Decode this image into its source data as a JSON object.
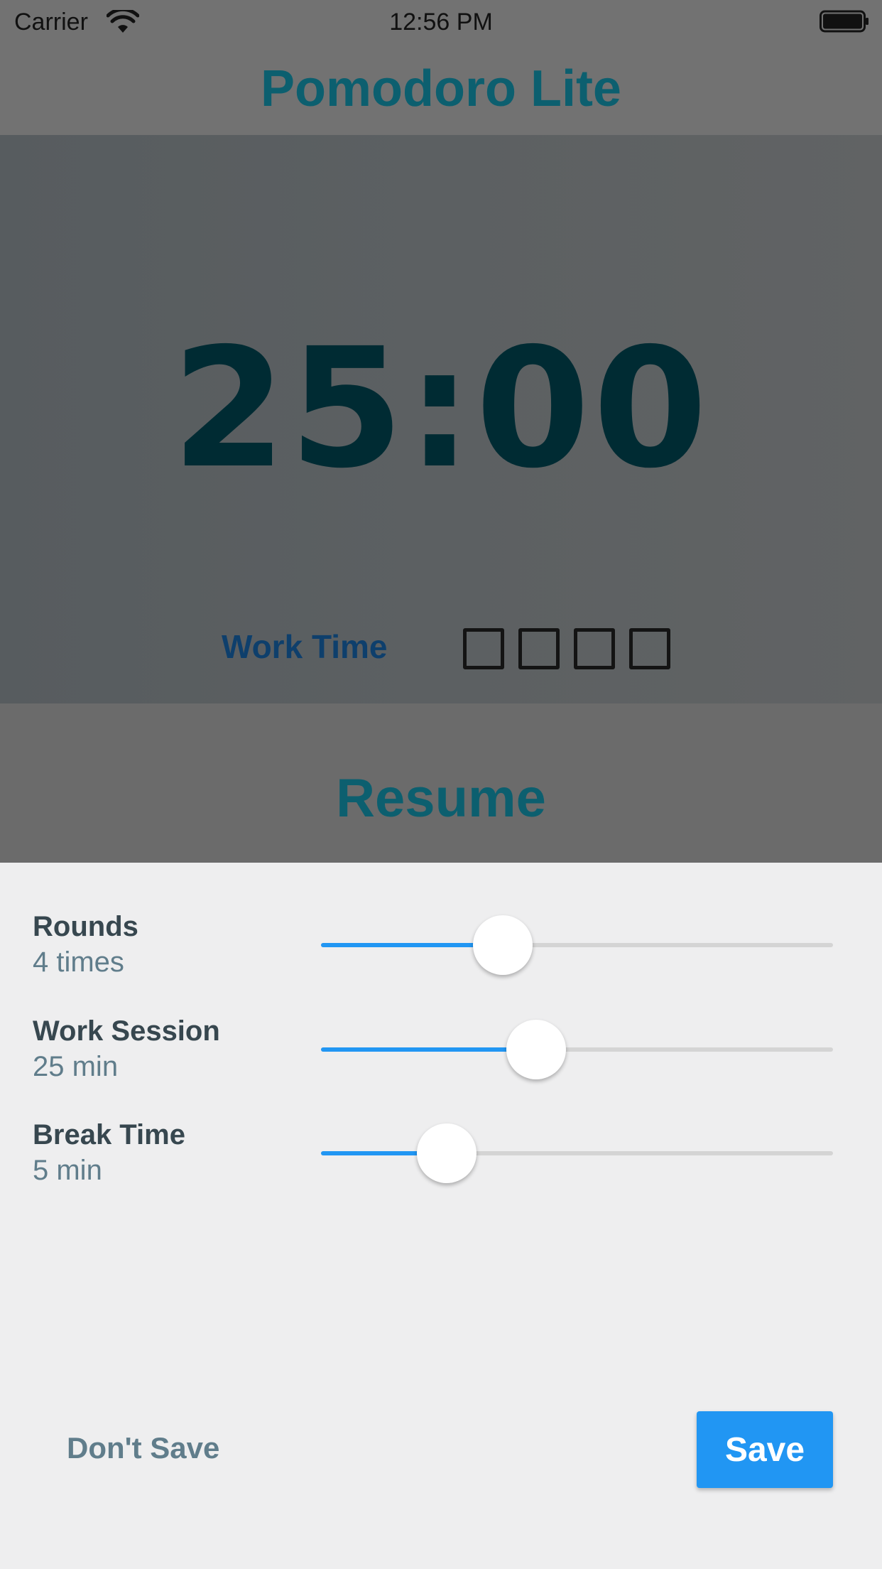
{
  "status_bar": {
    "carrier": "Carrier",
    "time": "12:56 PM",
    "wifi_icon": "wifi-icon",
    "battery_icon": "battery-full-icon"
  },
  "app": {
    "title": "Pomodoro Lite",
    "timer": "25:00",
    "phase": "Work Time",
    "rounds_indicator_count": 4,
    "resume_label": "Resume",
    "title_color": "#0c5f6f",
    "timer_color": "#002b33"
  },
  "settings": {
    "rounds": {
      "label": "Rounds",
      "value": "4 times",
      "slider_fraction": 0.355
    },
    "work_session": {
      "label": "Work Session",
      "value": "25 min",
      "slider_fraction": 0.42
    },
    "break_time": {
      "label": "Break Time",
      "value": "5 min",
      "slider_fraction": 0.245
    }
  },
  "actions": {
    "dont_save_label": "Don't Save",
    "save_label": "Save",
    "accent_color": "#2196f3"
  }
}
